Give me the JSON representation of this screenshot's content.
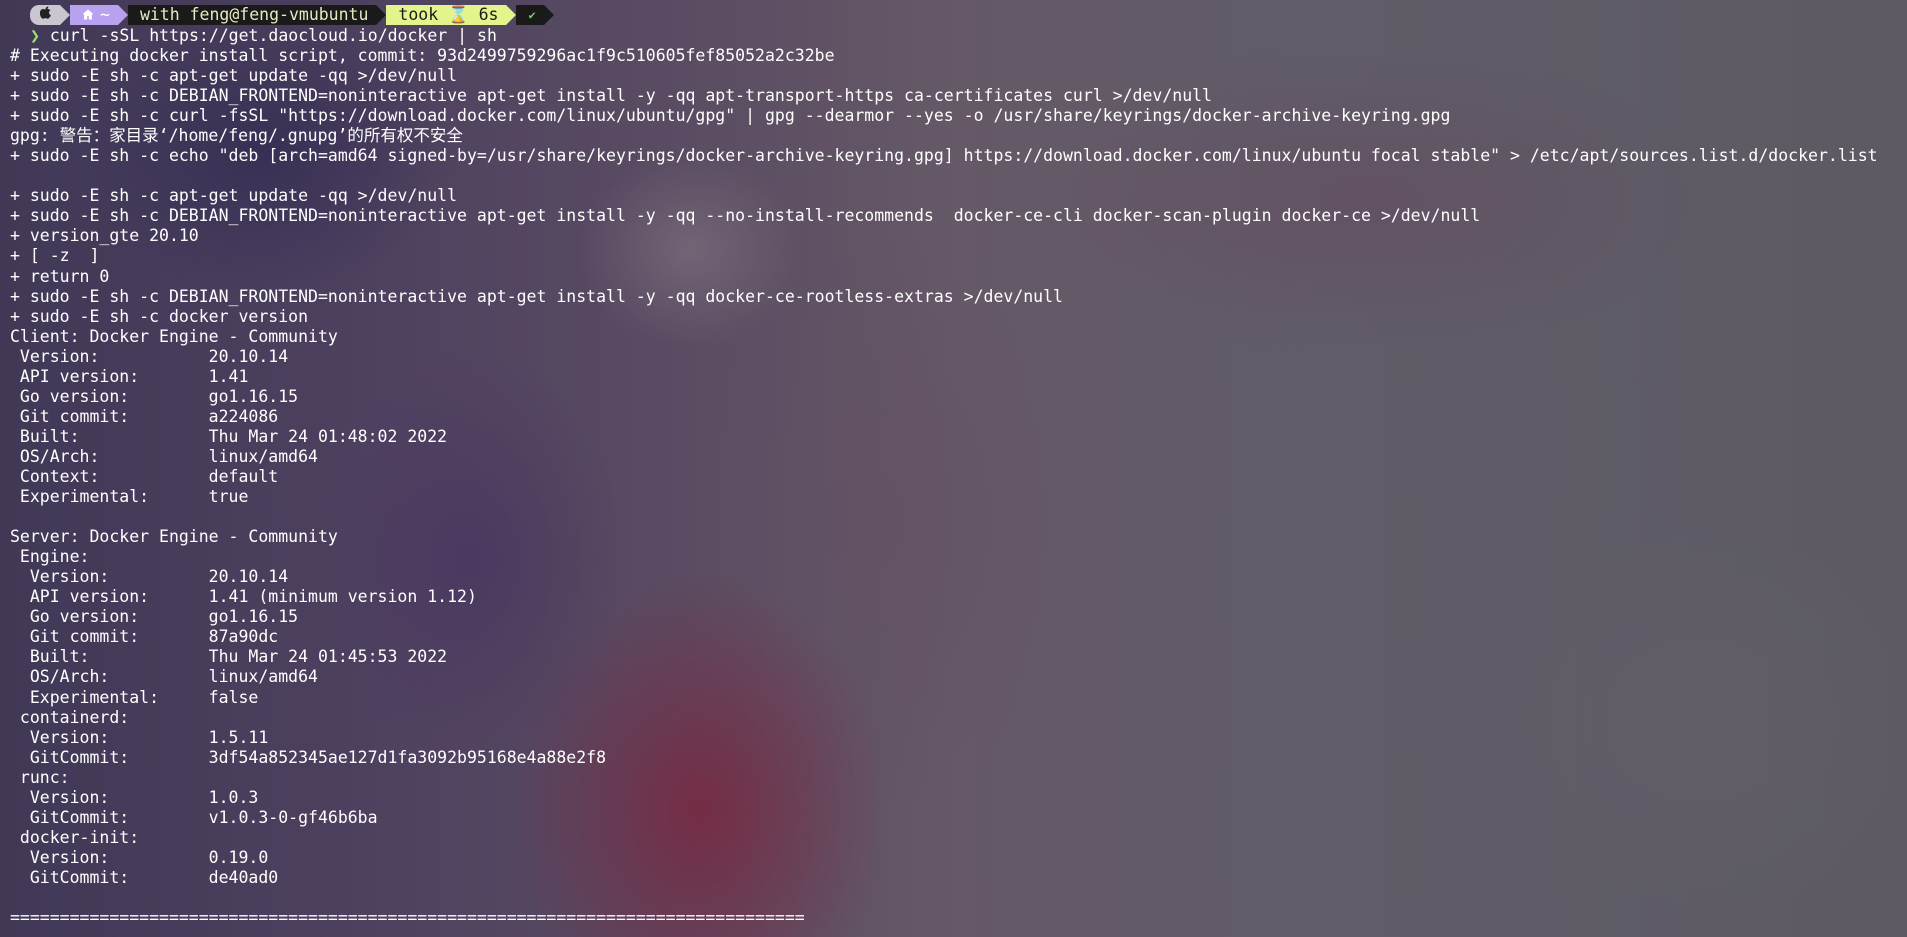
{
  "prompt": {
    "os_icon": "apple-logo-icon",
    "dir_icon": "home-icon",
    "dir_text": "~",
    "user_host": "with feng@feng-vmubuntu",
    "took_text": "took ⌛ 6s",
    "status_icon": "check-icon",
    "status_glyph": "✔",
    "arrow_glyph": "❯",
    "command": "curl -sSL https://get.daocloud.io/docker | sh"
  },
  "colors": {
    "prompt_os_bg": "#c9c6cf",
    "prompt_dir_bg": "#b8a2f0",
    "prompt_user_bg": "#1a1a1a",
    "prompt_took_bg": "#e2f58c",
    "prompt_arrow": "#9be26a",
    "status_ok": "#69d46a"
  },
  "output_lines": [
    "# Executing docker install script, commit: 93d2499759296ac1f9c510605fef85052a2c32be",
    "+ sudo -E sh -c apt-get update -qq >/dev/null",
    "+ sudo -E sh -c DEBIAN_FRONTEND=noninteractive apt-get install -y -qq apt-transport-https ca-certificates curl >/dev/null",
    "+ sudo -E sh -c curl -fsSL \"https://download.docker.com/linux/ubuntu/gpg\" | gpg --dearmor --yes -o /usr/share/keyrings/docker-archive-keyring.gpg",
    "gpg: 警告：家目录‘/home/feng/.gnupg’的所有权不安全",
    "+ sudo -E sh -c echo \"deb [arch=amd64 signed-by=/usr/share/keyrings/docker-archive-keyring.gpg] https://download.docker.com/linux/ubuntu focal stable\" > /etc/apt/sources.list.d/docker.list",
    "",
    "+ sudo -E sh -c apt-get update -qq >/dev/null",
    "+ sudo -E sh -c DEBIAN_FRONTEND=noninteractive apt-get install -y -qq --no-install-recommends  docker-ce-cli docker-scan-plugin docker-ce >/dev/null",
    "+ version_gte 20.10",
    "+ [ -z  ]",
    "+ return 0",
    "+ sudo -E sh -c DEBIAN_FRONTEND=noninteractive apt-get install -y -qq docker-ce-rootless-extras >/dev/null",
    "+ sudo -E sh -c docker version",
    "Client: Docker Engine - Community",
    " Version:           20.10.14",
    " API version:       1.41",
    " Go version:        go1.16.15",
    " Git commit:        a224086",
    " Built:             Thu Mar 24 01:48:02 2022",
    " OS/Arch:           linux/amd64",
    " Context:           default",
    " Experimental:      true",
    "",
    "Server: Docker Engine - Community",
    " Engine:",
    "  Version:          20.10.14",
    "  API version:      1.41 (minimum version 1.12)",
    "  Go version:       go1.16.15",
    "  Git commit:       87a90dc",
    "  Built:            Thu Mar 24 01:45:53 2022",
    "  OS/Arch:          linux/amd64",
    "  Experimental:     false",
    " containerd:",
    "  Version:          1.5.11",
    "  GitCommit:        3df54a852345ae127d1fa3092b95168e4a88e2f8",
    " runc:",
    "  Version:          1.0.3",
    "  GitCommit:        v1.0.3-0-gf46b6ba",
    " docker-init:",
    "  Version:          0.19.0",
    "  GitCommit:        de40ad0",
    "",
    "================================================================================"
  ]
}
